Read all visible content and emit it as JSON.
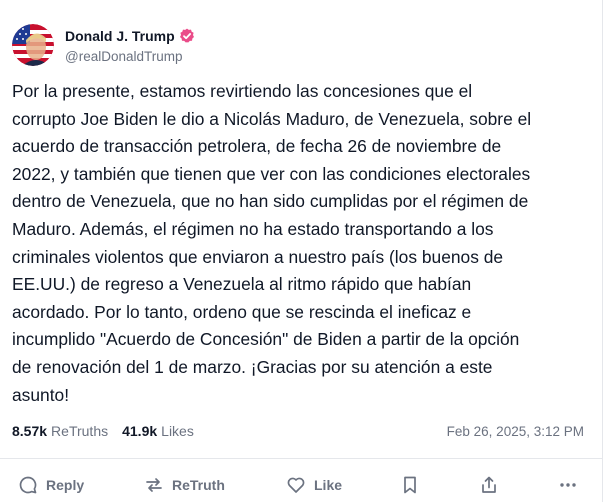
{
  "post": {
    "author": {
      "display_name": "Donald J. Trump",
      "handle": "@realDonaldTrump",
      "verified": true,
      "avatar_icon": "avatar-flag-portrait"
    },
    "body": "Por la presente, estamos revirtiendo las concesiones que el\ncorrupto Joe Biden le dio a Nicolás Maduro, de Venezuela, sobre el\nacuerdo de transacción petrolera, de fecha 26 de noviembre de\n2022, y también que tienen que ver con las condiciones electorales\ndentro de Venezuela, que no han sido cumplidas por el régimen de\nMaduro. Además, el régimen no ha estado transportando a los\ncriminales violentos que enviaron a nuestro país (los buenos de\nEE.UU.) de regreso a Venezuela al ritmo rápido que habían\nacordado. Por lo tanto, ordeno que se rescinda el ineficaz e\nincumplido \"Acuerdo de Concesión\" de Biden a partir de la opción\nde renovación del 1 de marzo. ¡Gracias por su atención a este\nasunto!",
    "stats": {
      "retruths_count": "8.57k",
      "retruths_label": "ReTruths",
      "likes_count": "41.9k",
      "likes_label": "Likes"
    },
    "timestamp": "Feb 26, 2025, 3:12 PM"
  },
  "actions": {
    "reply_label": "Reply",
    "retruth_label": "ReTruth",
    "like_label": "Like"
  },
  "colors": {
    "verified_badge": "#ea4c89",
    "muted_text": "#6b7280",
    "primary_text": "#101827"
  }
}
